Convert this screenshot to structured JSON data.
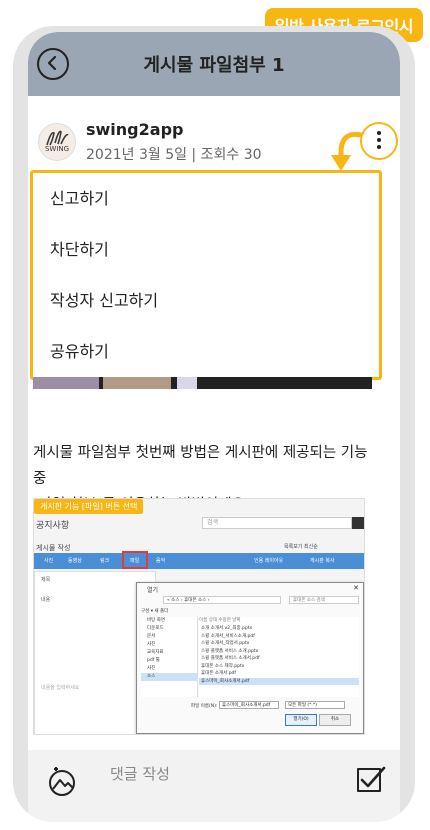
{
  "badge": "일반 사용자 로그인시",
  "header": {
    "title": "게시물 파일첨부 1"
  },
  "post": {
    "avatar_text": "SWING",
    "author": "swing2app",
    "meta": "2021년 3월 5일 | 조회수 30",
    "body_line1": "게시물 파일첨부 첫번째 방법은 게시판에 제공되는 기능 중",
    "body_line2": "[파일 첨부]를 이용하는 방법이에요!"
  },
  "menu": {
    "items": [
      {
        "label": "신고하기"
      },
      {
        "label": "차단하기"
      },
      {
        "label": "작성자 신고하기"
      },
      {
        "label": "공유하기"
      }
    ]
  },
  "embedded": {
    "tag": "게시판 기능 [파일] 버튼 선택",
    "title": "공지사항",
    "search": "검색",
    "subtitle": "게시물 작성",
    "opts": "목록보기   최신순",
    "toolbar": [
      "사진",
      "동영상",
      "링크",
      "파일",
      "음악",
      "인용 레이아웃",
      "게시판 복사"
    ],
    "editor_rows": [
      "제목",
      "내용",
      "내용을 입력하세요"
    ],
    "dialog": {
      "title": "열기",
      "path": "« 소스 › 휴대폰 소스 ›",
      "search": "휴대폰 소스 검색",
      "organize": "구성 ▾    새 폴더",
      "nav": [
        "바탕 화면",
        "다운로드",
        "문서",
        "사진",
        "교육자료",
        "pdf 툴",
        "사진",
        "소스"
      ],
      "files_header": "이름                              상태         수정한 날짜",
      "files": [
        "소개 소개서 v2_최종.pptx",
        "스윙 소개서_서비스소개.pdf",
        "스윙 소개서_작업서.pptx",
        "스윙 플랫폼 서비스 소개.pptx",
        "스윙 플랫폼 서비스 소개서.pdf",
        "휴대폰 소스 제작.pptx",
        "휴대폰 소개서.pdf",
        "휴스마이_회사소개서.pdf"
      ],
      "filename_label": "파일 이름(N):",
      "filename_value": "휴스마이_회사소개서.pdf",
      "filetype": "모든 파일 (*.*)",
      "open_label": "열기(O)",
      "cancel_label": "취소"
    }
  },
  "comment": {
    "placeholder": "댓글 작성"
  },
  "colors": {
    "accent": "#f7b614",
    "header_bg": "#9aa6b3"
  }
}
